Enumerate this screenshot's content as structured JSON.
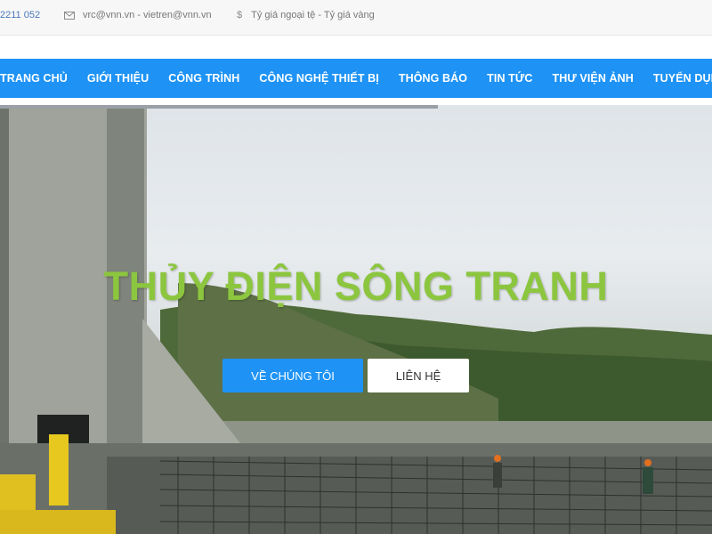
{
  "topbar": {
    "phone": "2211 052",
    "email_text": "vrc@vnn.vn - vietren@vnn.vn",
    "rates_text": "Tỷ giá ngoại tệ - Tỷ giá vàng",
    "email_icon": "envelope-icon",
    "rates_icon": "dollar-icon"
  },
  "nav": {
    "items": [
      "TRANG CHỦ",
      "GIỚI THIỆU",
      "CÔNG TRÌNH",
      "CÔNG NGHỆ THIẾT BỊ",
      "THÔNG BÁO",
      "TIN TỨC",
      "THƯ VIỆN ẢNH",
      "TUYỂN DỤNG"
    ]
  },
  "hero": {
    "title": "THỦY ĐIỆN SÔNG TRANH",
    "primary_button": "VỀ CHÚNG TÔI",
    "secondary_button": "LIÊN HỆ"
  },
  "colors": {
    "brand_blue": "#1e93f5",
    "title_green": "#8cc63f"
  }
}
